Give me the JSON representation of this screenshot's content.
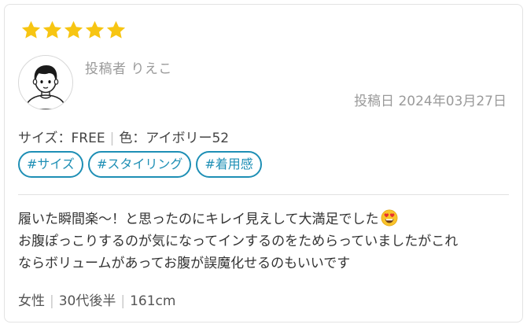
{
  "review": {
    "rating": 5,
    "stars": [
      "star-filled",
      "star-filled",
      "star-filled",
      "star-filled",
      "star-filled"
    ],
    "poster_label": "投稿者 りえこ",
    "post_date": "投稿日 2024年03月27日",
    "attributes": {
      "size": "サイズ：FREE",
      "color": "色：アイボリー52"
    },
    "tags": [
      "#サイズ",
      "#スタイリング",
      "#着用感"
    ],
    "body": {
      "line1": "履いた瞬間楽〜！と思ったのにキレイ見えして大満足でした",
      "line1_emoji": "heart-eyes-emoji",
      "line2": "お腹ぽっこりするのが気になってインするのをためらっていましたがこれ",
      "line3": "ならボリュームがあってお腹が誤魔化せるのもいいです"
    },
    "profile": {
      "gender": "女性",
      "age": "30代後半",
      "height": "161cm"
    }
  },
  "colors": {
    "star": "#F7C512",
    "tag": "#1E8FB5",
    "muted_text": "#9A9A9A",
    "divider": "#E1E1E1"
  }
}
